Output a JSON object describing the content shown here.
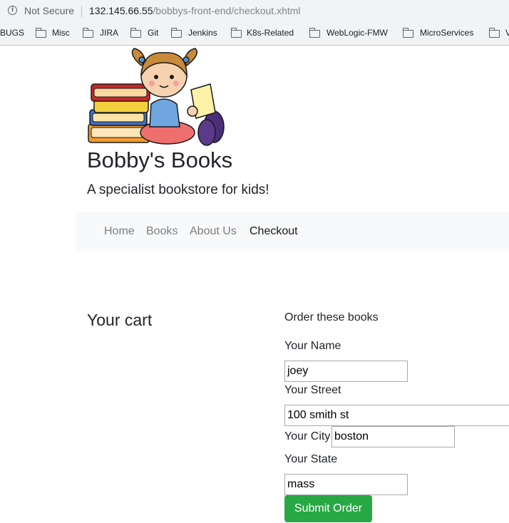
{
  "browser": {
    "security_label": "Not Secure",
    "url_host": "132.145.66.55",
    "url_path": "/bobbys-front-end/checkout.xhtml",
    "bookmarks": [
      "BUGS",
      "Misc",
      "JIRA",
      "Git",
      "Jenkins",
      "K8s-Related",
      "WebLogic-FMW",
      "MicroServices",
      "V"
    ]
  },
  "site": {
    "name": "Bobby's Books",
    "tagline": "A specialist bookstore for kids!"
  },
  "nav": {
    "home": "Home",
    "books": "Books",
    "about": "About Us",
    "checkout": "Checkout"
  },
  "cart": {
    "title": "Your cart"
  },
  "order": {
    "heading": "Order these books",
    "name_label": "Your Name",
    "name_value": "joey",
    "street_label": "Your Street",
    "street_value": "100 smith st",
    "city_label": "Your City",
    "city_value": "boston",
    "state_label": "Your State",
    "state_value": "mass",
    "submit_label": "Submit Order"
  },
  "colors": {
    "submit": "#28a745",
    "navbar": "#f8f9fa"
  }
}
